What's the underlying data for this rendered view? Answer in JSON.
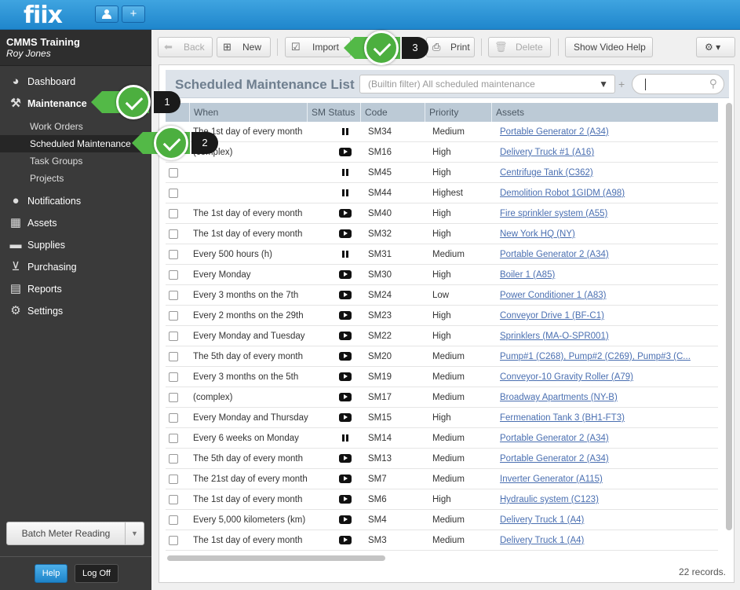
{
  "app": {
    "logo": "fiix",
    "user_btn_icon": "user-icon",
    "add_btn_label": "+"
  },
  "user": {
    "company": "CMMS Training",
    "name": "Roy Jones"
  },
  "nav": {
    "dashboard": "Dashboard",
    "maintenance": "Maintenance",
    "sub": [
      "Work Orders",
      "Scheduled Maintenance",
      "Task Groups",
      "Projects"
    ],
    "notifications": "Notifications",
    "assets": "Assets",
    "supplies": "Supplies",
    "purchasing": "Purchasing",
    "reports": "Reports",
    "settings": "Settings"
  },
  "sidebar_bottom": {
    "batch": "Batch Meter Reading",
    "help": "Help",
    "logoff": "Log Off"
  },
  "toolbar": {
    "back": "Back",
    "new": "New",
    "import": "Import",
    "print": "Print",
    "delete": "Delete",
    "video": "Show Video Help"
  },
  "list": {
    "title": "Scheduled Maintenance List",
    "filter": "(Builtin filter) All scheduled maintenance",
    "columns": {
      "when": "When",
      "status": "SM Status",
      "code": "Code",
      "priority": "Priority",
      "assets": "Assets"
    },
    "rows": [
      {
        "when": "The 1st day of every month",
        "status": "paused",
        "code": "SM34",
        "priority": "Medium",
        "assets": "Portable Generator 2 (A34)"
      },
      {
        "when": "(complex)",
        "status": "active",
        "code": "SM16",
        "priority": "High",
        "assets": "Delivery Truck #1 (A16)"
      },
      {
        "when": "",
        "status": "paused",
        "code": "SM45",
        "priority": "High",
        "assets": "Centrifuge Tank (C362)"
      },
      {
        "when": "",
        "status": "paused",
        "code": "SM44",
        "priority": "Highest",
        "assets": "Demolition Robot 1GIDM (A98)"
      },
      {
        "when": "The 1st day of every month",
        "status": "active",
        "code": "SM40",
        "priority": "High",
        "assets": "Fire sprinkler system (A55)"
      },
      {
        "when": "The 1st day of every month",
        "status": "active",
        "code": "SM32",
        "priority": "High",
        "assets": "New York HQ (NY)"
      },
      {
        "when": "Every 500 hours (h)",
        "status": "paused",
        "code": "SM31",
        "priority": "Medium",
        "assets": "Portable Generator 2 (A34)"
      },
      {
        "when": "Every Monday",
        "status": "active",
        "code": "SM30",
        "priority": "High",
        "assets": "Boiler 1 (A85)"
      },
      {
        "when": "Every 3 months on the 7th",
        "status": "active",
        "code": "SM24",
        "priority": "Low",
        "assets": "Power Conditioner 1 (A83)"
      },
      {
        "when": "Every 2 months on the 29th",
        "status": "active",
        "code": "SM23",
        "priority": "High",
        "assets": "Conveyor Drive 1 (BF-C1)"
      },
      {
        "when": "Every Monday and Tuesday",
        "status": "active",
        "code": "SM22",
        "priority": "High",
        "assets": "Sprinklers (MA-O-SPR001)"
      },
      {
        "when": "The 5th day of every month",
        "status": "active",
        "code": "SM20",
        "priority": "Medium",
        "assets": "Pump#1 (C268), Pump#2 (C269), Pump#3 (C..."
      },
      {
        "when": "Every 3 months on the 5th",
        "status": "active",
        "code": "SM19",
        "priority": "Medium",
        "assets": "Conveyor-10 Gravity Roller (A79)"
      },
      {
        "when": "(complex)",
        "status": "active",
        "code": "SM17",
        "priority": "Medium",
        "assets": "Broadway Apartments (NY-B)"
      },
      {
        "when": "Every Monday and Thursday",
        "status": "active",
        "code": "SM15",
        "priority": "High",
        "assets": "Fermenation Tank 3 (BH1-FT3)"
      },
      {
        "when": "Every 6 weeks on Monday",
        "status": "paused",
        "code": "SM14",
        "priority": "Medium",
        "assets": "Portable Generator 2 (A34)"
      },
      {
        "when": "The 5th day of every month",
        "status": "active",
        "code": "SM13",
        "priority": "Medium",
        "assets": "Portable Generator 2 (A34)"
      },
      {
        "when": "The 21st day of every month",
        "status": "active",
        "code": "SM7",
        "priority": "Medium",
        "assets": "Inverter Generator (A115)"
      },
      {
        "when": "The 1st day of every month",
        "status": "active",
        "code": "SM6",
        "priority": "High",
        "assets": "Hydraulic system (C123)"
      },
      {
        "when": "Every 5,000 kilometers (km)",
        "status": "active",
        "code": "SM4",
        "priority": "Medium",
        "assets": "Delivery Truck 1 (A4)"
      },
      {
        "when": "The 1st day of every month",
        "status": "active",
        "code": "SM3",
        "priority": "Medium",
        "assets": "Delivery Truck 1 (A4)"
      }
    ],
    "records": "22 records."
  },
  "callouts": [
    "1",
    "2",
    "3"
  ],
  "colors": {
    "topbar": "#2a93d6",
    "sidebar": "#3a3a3a",
    "callout_green": "#53b947",
    "link": "#4a6fb1"
  }
}
